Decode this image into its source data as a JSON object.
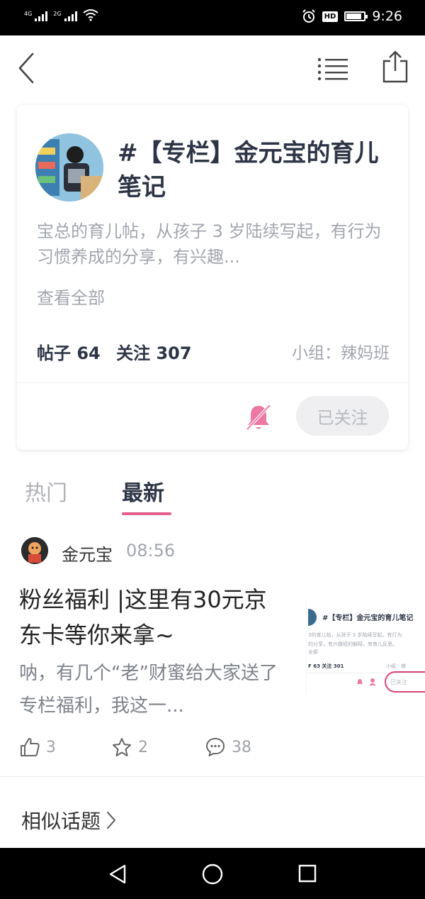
{
  "status_bar": {
    "net1": "4G",
    "net2": "2G",
    "hd_label": "HD",
    "time": "9:26"
  },
  "card": {
    "title": "#【专栏】金元宝的育儿笔记",
    "description": "宝总的育儿帖，从孩子 3 岁陆续写起，有行为习惯养成的分享，有兴趣...",
    "view_all": "查看全部",
    "posts_label": "帖子 64",
    "follows_label": "关注 307",
    "group": "小组：辣妈班",
    "follow_button": "已关注"
  },
  "tabs": {
    "hot": "热门",
    "latest": "最新"
  },
  "post": {
    "author": "金元宝",
    "time": "08:56",
    "title": "粉丝福利 |这里有30元京东卡等你来拿~",
    "excerpt": "呐，有几个“老”财蜜给大家送了专栏福利，我这一...",
    "thumb": {
      "title": "#【专栏】金元宝的育儿笔记",
      "line1": "3的育儿帖，从孩子 3 岁陆续写起，有行为",
      "line2": "的分享，有兴趣班的解释，有育儿反思。",
      "line3": "全部",
      "stats": "F 63  关注 301",
      "group": "小组：辣",
      "follow": "已关注"
    },
    "likes": "3",
    "favorites": "2",
    "comments": "38"
  },
  "similar_topics": "相似话题",
  "colors": {
    "accent": "#e55f8d",
    "title_text": "#2e3546",
    "muted_text": "#a2a6ad"
  }
}
